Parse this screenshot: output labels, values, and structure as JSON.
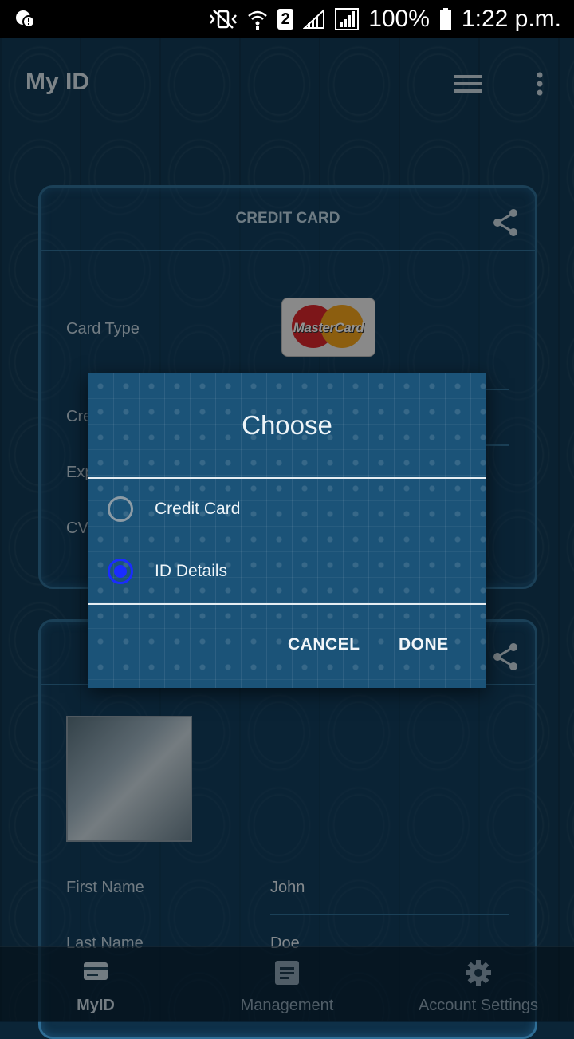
{
  "status_bar": {
    "battery": "100%",
    "time": "1:22 p.m.",
    "sim_slot": "2"
  },
  "app_bar": {
    "title": "My ID"
  },
  "credit_card": {
    "title": "CREDIT CARD",
    "card_type_label": "Card Type",
    "card_brand_logo": "MasterCard",
    "row2_label_partial": "Cre",
    "row3_label_partial": "Exp",
    "row4_label_partial": "CV"
  },
  "id_details": {
    "first_name_label": "First Name",
    "first_name_value": "John",
    "last_name_label": "Last Name",
    "last_name_value": "Doe"
  },
  "dialog": {
    "title": "Choose",
    "options": [
      {
        "label": "Credit Card",
        "selected": false
      },
      {
        "label": "ID Details",
        "selected": true
      }
    ],
    "cancel_label": "CANCEL",
    "done_label": "DONE"
  },
  "bottom_nav": {
    "items": [
      {
        "label": "MyID",
        "icon": "card-icon",
        "active": true
      },
      {
        "label": "Management",
        "icon": "document-icon",
        "active": false
      },
      {
        "label": "Account Settings",
        "icon": "gear-icon",
        "active": false
      }
    ]
  },
  "colors": {
    "background": "#123a55",
    "card_border": "#2f6e96",
    "dialog_bg": "#1b5378",
    "radio_selected": "#1a2cff"
  }
}
